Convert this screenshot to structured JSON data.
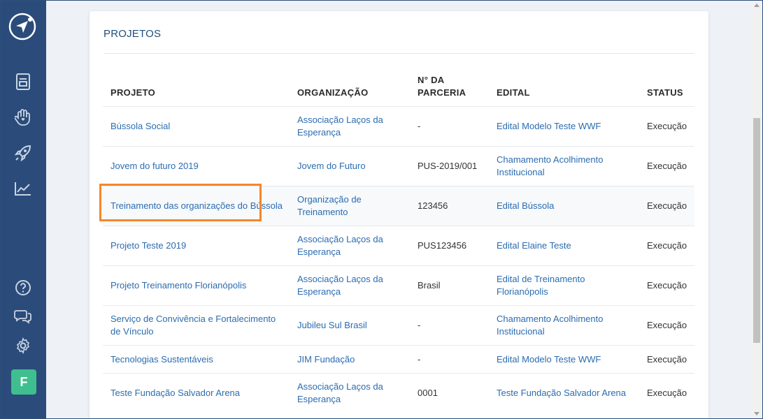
{
  "sidebar": {
    "items": [
      {
        "icon": "document-icon"
      },
      {
        "icon": "hand-heart-icon"
      },
      {
        "icon": "rocket-icon"
      },
      {
        "icon": "chart-line-icon"
      }
    ],
    "bottom": [
      {
        "icon": "help-icon"
      },
      {
        "icon": "chat-icon"
      },
      {
        "icon": "gear-icon"
      }
    ],
    "avatar_letter": "F",
    "accent": "#2b4c7a",
    "avatar_color": "#3fbf8f"
  },
  "card": {
    "title": "PROJETOS"
  },
  "table": {
    "headers": {
      "projeto": "PROJETO",
      "organizacao": "ORGANIZAÇÃO",
      "parceria_1": "N° DA",
      "parceria_2": "PARCERIA",
      "edital": "EDITAL",
      "status": "STATUS"
    },
    "rows": [
      {
        "projeto": "Bússola Social",
        "organizacao": "Associação Laços da Esperança",
        "parceria": "-",
        "edital": "Edital Modelo Teste WWF",
        "status": "Execução"
      },
      {
        "projeto": "Jovem do futuro 2019",
        "organizacao": "Jovem do Futuro",
        "parceria": "PUS-2019/001",
        "edital": "Chamamento Acolhimento Institucional",
        "status": "Execução"
      },
      {
        "projeto": "Treinamento das organizações do Bússola",
        "organizacao": "Organização de Treinamento",
        "parceria": "123456",
        "edital": "Edital Bússola",
        "status": "Execução"
      },
      {
        "projeto": "Projeto Teste 2019",
        "organizacao": "Associação Laços da Esperança",
        "parceria": "PUS123456",
        "edital": "Edital Elaine Teste",
        "status": "Execução"
      },
      {
        "projeto": "Projeto Treinamento Florianópolis",
        "organizacao": "Associação Laços da Esperança",
        "parceria": "Brasil",
        "edital": "Edital de Treinamento Florianópolis",
        "status": "Execução"
      },
      {
        "projeto": "Serviço de Convivência e Fortalecimento de Vínculo",
        "organizacao": "Jubileu Sul Brasil",
        "parceria": "-",
        "edital": "Chamamento Acolhimento Institucional",
        "status": "Execução"
      },
      {
        "projeto": "Tecnologias Sustentáveis",
        "organizacao": "JIM Fundação",
        "parceria": "-",
        "edital": "Edital Modelo Teste WWF",
        "status": "Execução"
      },
      {
        "projeto": "Teste Fundação Salvador Arena",
        "organizacao": "Associação Laços da Esperança",
        "parceria": "0001",
        "edital": "Teste Fundação Salvador Arena",
        "status": "Execução"
      }
    ],
    "link_color": "#2b6cb0",
    "highlight_color": "#f5862b"
  }
}
